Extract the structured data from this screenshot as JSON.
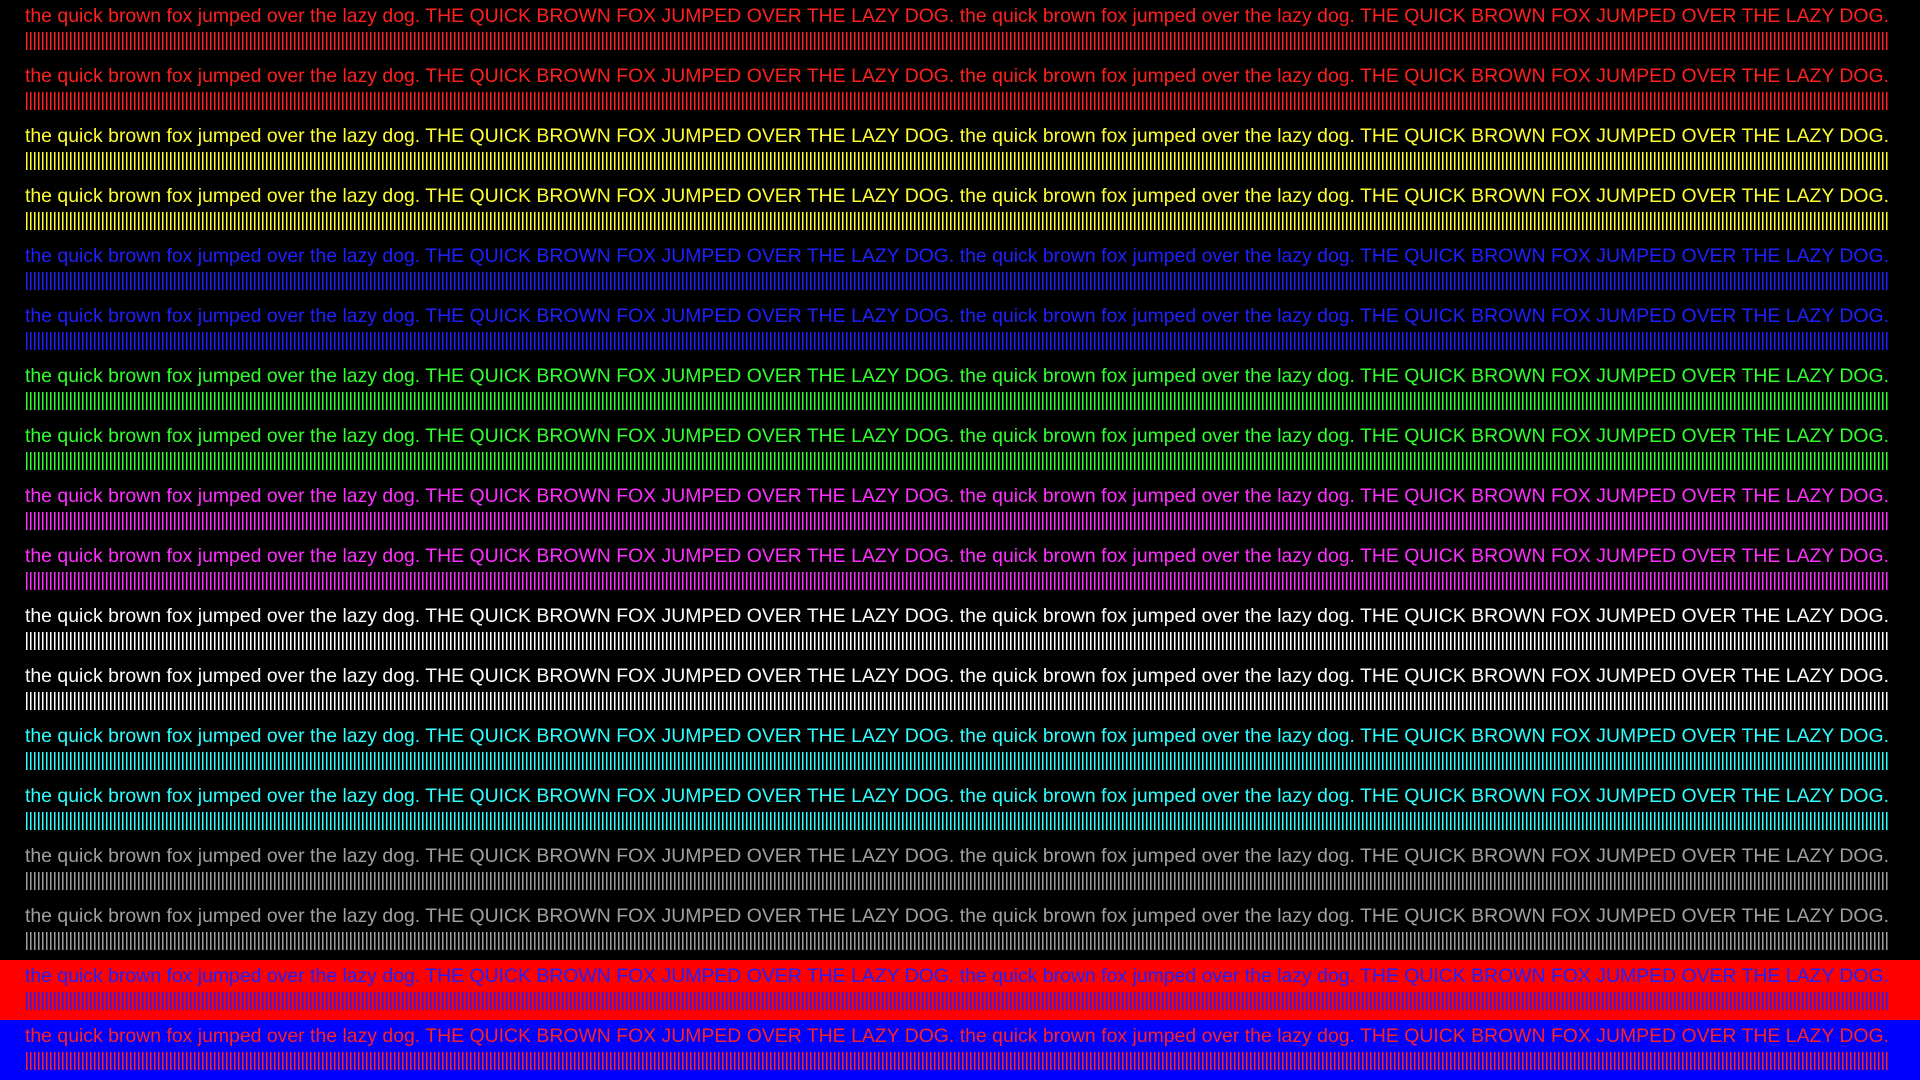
{
  "test_line": "the quick brown fox jumped over the lazy dog. THE QUICK BROWN FOX JUMPED OVER THE LAZY DOG. the quick brown fox jumped over the lazy dog. THE QUICK BROWN FOX JUMPED OVER THE LAZY DOG.",
  "rows": [
    {
      "fg": "#ff2020",
      "bg": "#000000",
      "pattern": "vertical-lines"
    },
    {
      "fg": "#ff2020",
      "bg": "#000000",
      "pattern": "vertical-lines"
    },
    {
      "fg": "#ffff30",
      "bg": "#000000",
      "pattern": "vertical-lines"
    },
    {
      "fg": "#ffff30",
      "bg": "#000000",
      "pattern": "vertical-lines"
    },
    {
      "fg": "#2020ff",
      "bg": "#000000",
      "pattern": "vertical-lines"
    },
    {
      "fg": "#2020ff",
      "bg": "#000000",
      "pattern": "vertical-lines"
    },
    {
      "fg": "#30ff30",
      "bg": "#000000",
      "pattern": "vertical-lines"
    },
    {
      "fg": "#30ff30",
      "bg": "#000000",
      "pattern": "vertical-lines"
    },
    {
      "fg": "#ff30ff",
      "bg": "#000000",
      "pattern": "vertical-lines"
    },
    {
      "fg": "#ff30ff",
      "bg": "#000000",
      "pattern": "vertical-lines"
    },
    {
      "fg": "#ffffff",
      "bg": "#000000",
      "pattern": "vertical-lines"
    },
    {
      "fg": "#ffffff",
      "bg": "#000000",
      "pattern": "vertical-lines"
    },
    {
      "fg": "#30ffff",
      "bg": "#000000",
      "pattern": "vertical-lines"
    },
    {
      "fg": "#30ffff",
      "bg": "#000000",
      "pattern": "vertical-lines"
    },
    {
      "fg": "#a0a0a0",
      "bg": "#000000",
      "pattern": "vertical-lines"
    },
    {
      "fg": "#a0a0a0",
      "bg": "#000000",
      "pattern": "vertical-lines"
    },
    {
      "fg": "#2020ff",
      "bg": "#ff0000",
      "pattern": "vertical-lines"
    },
    {
      "fg": "#ff2020",
      "bg": "#0000ff",
      "pattern": "vertical-lines"
    }
  ]
}
